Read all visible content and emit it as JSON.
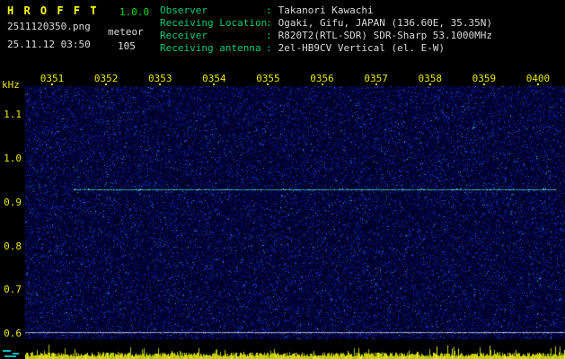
{
  "header": {
    "app_title": "H R O F F T",
    "app_version": "1.0.0",
    "filename": "2511120350.png",
    "mode_label": "meteor",
    "datetime": "25.11.12 03:50",
    "count": "105",
    "info_rows": [
      {
        "label": "Observer",
        "value": "Takanori Kawachi"
      },
      {
        "label": "Receiving Location",
        "value": "Ogaki, Gifu, JAPAN (136.60E, 35.35N)"
      },
      {
        "label": "Receiver",
        "value": "R820T2(RTL-SDR) SDR-Sharp 53.1000MHz"
      },
      {
        "label": "Receiving antenna",
        "value": "2el-HB9CV Vertical (el. E-W)"
      }
    ]
  },
  "chart_data": {
    "type": "heatmap",
    "title": "HROFFT 10-minute meteor-echo spectrogram, 25.11.12 03:50-04:00",
    "x_ticks": [
      "0351",
      "0352",
      "0353",
      "0354",
      "0355",
      "0356",
      "0357",
      "0358",
      "0359",
      "0400"
    ],
    "y_unit_label": "kHz",
    "y_ticks": [
      "1.1",
      "1.0",
      "0.9",
      "0.8",
      "0.7",
      "0.6"
    ],
    "ylim": [
      0.588,
      1.166
    ],
    "grid": false,
    "background": "dense dark-blue random noise, no meteor echo bursts visible",
    "signals": [
      {
        "name": "direct-carrier-line",
        "freq_khz": 0.93,
        "start_x_frac": 0.09,
        "end_x_frac": 0.985,
        "color": "#46ebcd"
      },
      {
        "name": "baseline-line",
        "freq_khz": 0.605,
        "start_x_frac": 0.0,
        "end_x_frac": 1.0,
        "color": "#cdcde1"
      }
    ],
    "noise_background_color": "#000030",
    "level_strip": {
      "name": "signal-level-bars",
      "bar_color": "#d2d200",
      "alt_color": "#a8c800",
      "bright_color": "#e8e830"
    }
  },
  "colors": {
    "title": "#ffff00",
    "version": "#00dd00",
    "axis_text": "#e8e800",
    "info_label": "#00cc77",
    "info_value": "#d8d8d8",
    "plain_text": "#dcdcdc"
  }
}
